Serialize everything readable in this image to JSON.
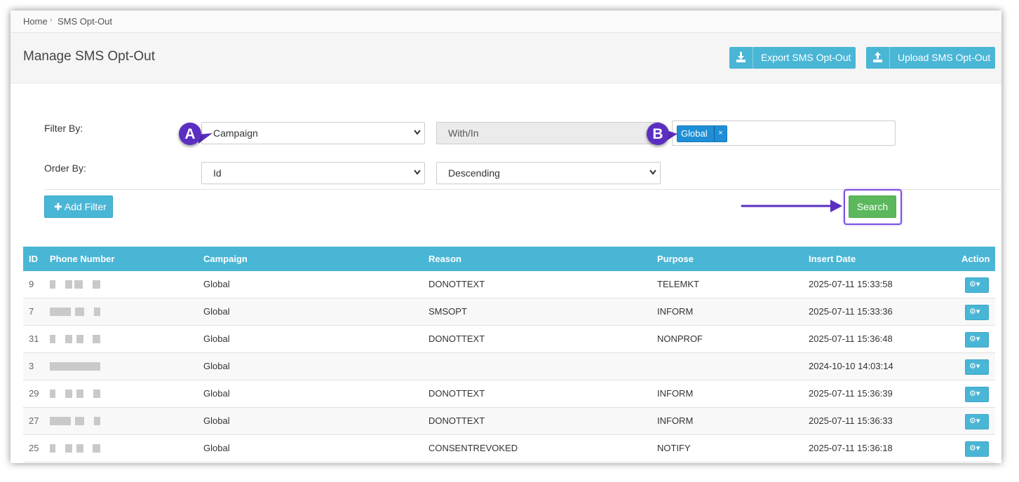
{
  "breadcrumb": {
    "home": "Home",
    "current": "SMS Opt-Out"
  },
  "header": {
    "title": "Manage SMS Opt-Out",
    "export_label": "Export SMS Opt-Out",
    "upload_label": "Upload SMS Opt-Out"
  },
  "filter": {
    "filter_by_label": "Filter By:",
    "field_value": "Campaign",
    "operator_value": "With/In",
    "tag_value": "Global",
    "tag_remove": "×"
  },
  "order": {
    "order_by_label": "Order By:",
    "field_value": "Id",
    "direction_value": "Descending"
  },
  "buttons": {
    "add_filter": "Add Filter",
    "search": "Search"
  },
  "callouts": {
    "a": "A",
    "b": "B"
  },
  "table": {
    "headers": [
      "ID",
      "Phone Number",
      "Campaign",
      "Reason",
      "Purpose",
      "Insert Date",
      "Action"
    ],
    "rows": [
      {
        "id": "9",
        "campaign": "Global",
        "reason": "DONOTTEXT",
        "purpose": "TELEMKT",
        "date": "2025-07-11 15:33:58"
      },
      {
        "id": "7",
        "campaign": "Global",
        "reason": "SMSOPT",
        "purpose": "INFORM",
        "date": "2025-07-11 15:33:36"
      },
      {
        "id": "31",
        "campaign": "Global",
        "reason": "DONOTTEXT",
        "purpose": "NONPROF",
        "date": "2025-07-11 15:36:48"
      },
      {
        "id": "3",
        "campaign": "Global",
        "reason": "",
        "purpose": "",
        "date": "2024-10-10 14:03:14"
      },
      {
        "id": "29",
        "campaign": "Global",
        "reason": "DONOTTEXT",
        "purpose": "INFORM",
        "date": "2025-07-11 15:36:39"
      },
      {
        "id": "27",
        "campaign": "Global",
        "reason": "DONOTTEXT",
        "purpose": "INFORM",
        "date": "2025-07-11 15:36:33"
      },
      {
        "id": "25",
        "campaign": "Global",
        "reason": "CONSENTREVOKED",
        "purpose": "NOTIFY",
        "date": "2025-07-11 15:36:18"
      }
    ]
  },
  "colors": {
    "accent": "#4ab6d5",
    "success": "#5cb85c",
    "tag": "#1e8fd6",
    "callout": "#5b2fc1"
  }
}
